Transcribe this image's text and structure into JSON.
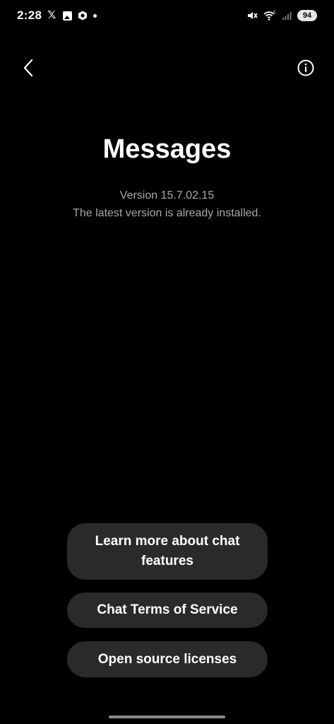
{
  "status_bar": {
    "time": "2:28",
    "battery": "94",
    "icons": [
      "x-icon",
      "gallery-icon",
      "hex-app-icon",
      "notification-dot",
      "mute-icon",
      "wifi-icon",
      "signal-icon"
    ]
  },
  "header": {
    "back_icon": "chevron-left-icon",
    "info_icon": "info-icon"
  },
  "main": {
    "title": "Messages",
    "version": "Version 15.7.02.15",
    "status": "The latest version is already installed."
  },
  "buttons": {
    "learn_more": "Learn more about chat features",
    "terms": "Chat Terms of Service",
    "open_source": "Open source licenses"
  },
  "colors": {
    "background": "#000000",
    "button_bg": "#2a2a2a",
    "secondary_text": "#a8a8a8"
  }
}
